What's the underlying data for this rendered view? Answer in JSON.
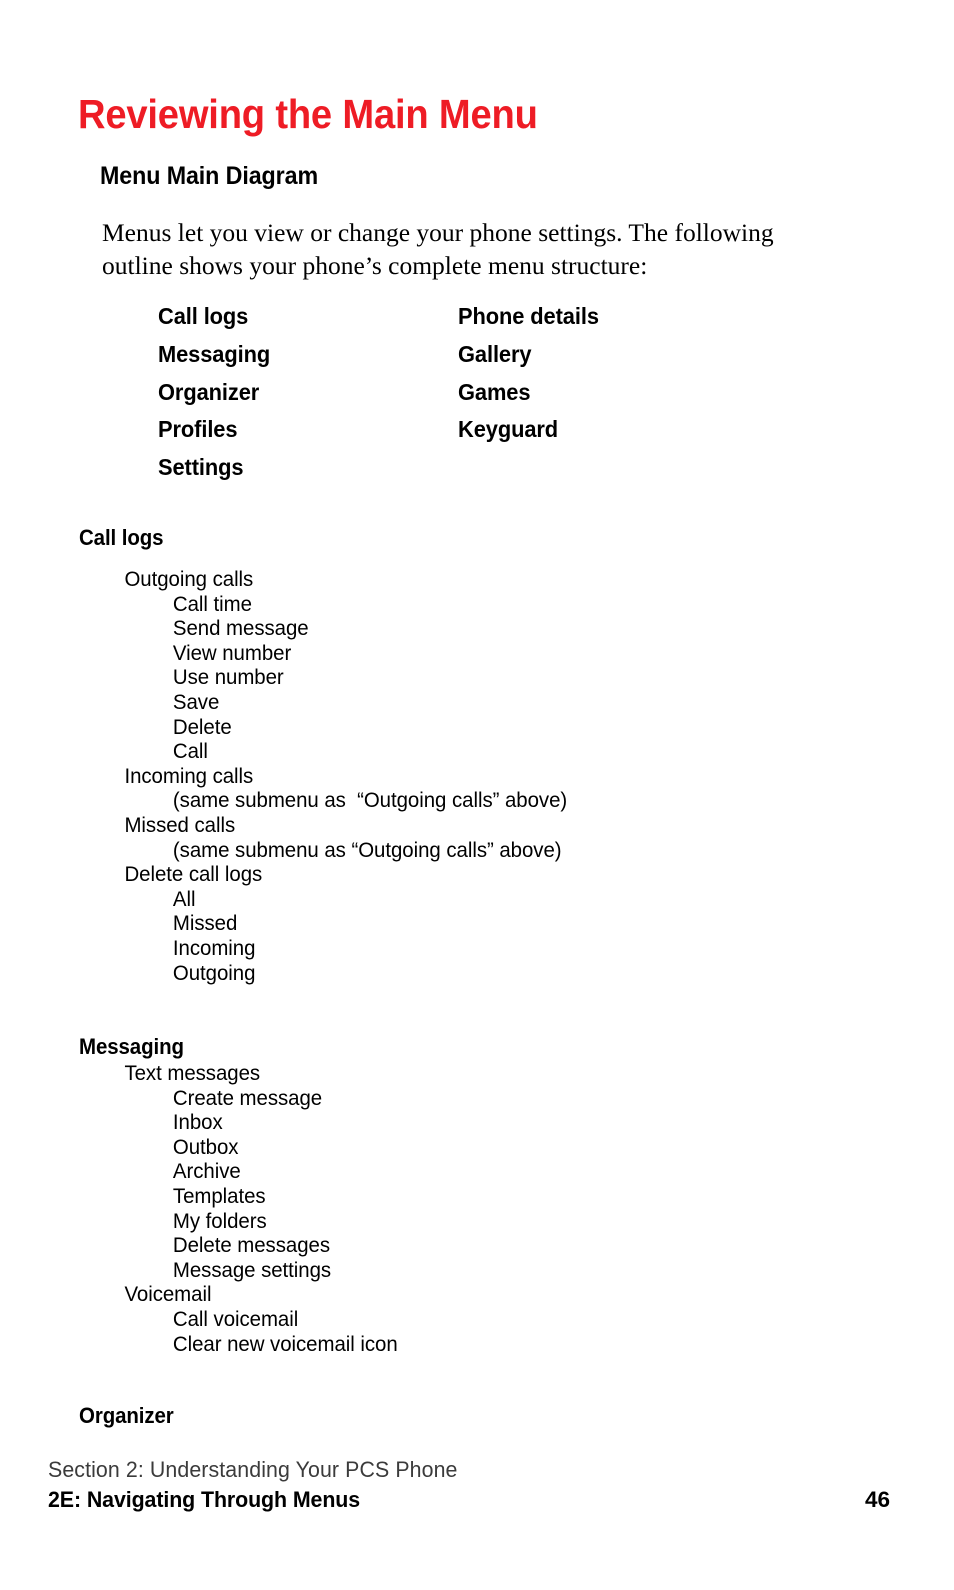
{
  "page": {
    "title": "Reviewing the Main Menu",
    "sub_heading": "Menu Main Diagram",
    "intro": "Menus let you view or change your phone settings. The following outline shows your phone’s complete menu structure:",
    "title_color": "#ee1c25",
    "text_color": "#000000",
    "footer_section_color": "#3b3b3b",
    "background_color": "#ffffff"
  },
  "main_menu": {
    "left_column": [
      {
        "label": "Call logs"
      },
      {
        "label": "Messaging"
      },
      {
        "label": "Organizer"
      },
      {
        "label": "Profiles"
      },
      {
        "label": "Settings"
      }
    ],
    "right_column": [
      {
        "label": "Phone details"
      },
      {
        "label": "Gallery"
      },
      {
        "label": "Games"
      },
      {
        "label": "Keyguard"
      }
    ]
  },
  "sections": [
    {
      "heading": "Call logs",
      "rows": [
        {
          "level": 1,
          "text": "Outgoing calls"
        },
        {
          "level": 2,
          "text": "Call time"
        },
        {
          "level": 2,
          "text": "Send message"
        },
        {
          "level": 2,
          "text": "View number"
        },
        {
          "level": 2,
          "text": "Use number"
        },
        {
          "level": 2,
          "text": "Save"
        },
        {
          "level": 2,
          "text": "Delete"
        },
        {
          "level": 2,
          "text": "Call"
        },
        {
          "level": 1,
          "text": "Incoming calls"
        },
        {
          "level": 2,
          "text": "(same submenu as  “Outgoing calls” above)"
        },
        {
          "level": 1,
          "text": "Missed calls"
        },
        {
          "level": 2,
          "text": "(same submenu as “Outgoing calls” above)"
        },
        {
          "level": 1,
          "text": "Delete call logs"
        },
        {
          "level": 2,
          "text": "All"
        },
        {
          "level": 2,
          "text": "Missed"
        },
        {
          "level": 2,
          "text": "Incoming"
        },
        {
          "level": 2,
          "text": "Outgoing"
        }
      ]
    },
    {
      "heading": "Messaging",
      "rows": [
        {
          "level": 1,
          "text": "Text messages"
        },
        {
          "level": 2,
          "text": "Create message"
        },
        {
          "level": 2,
          "text": "Inbox"
        },
        {
          "level": 2,
          "text": "Outbox"
        },
        {
          "level": 2,
          "text": "Archive"
        },
        {
          "level": 2,
          "text": "Templates"
        },
        {
          "level": 2,
          "text": "My folders"
        },
        {
          "level": 2,
          "text": "Delete messages"
        },
        {
          "level": 2,
          "text": "Message settings"
        },
        {
          "level": 1,
          "text": "Voicemail"
        },
        {
          "level": 2,
          "text": "Call voicemail"
        },
        {
          "level": 2,
          "text": "Clear new voicemail icon"
        }
      ]
    },
    {
      "heading": "Organizer",
      "rows": []
    }
  ],
  "footer": {
    "section_line": "Section 2: Understanding Your PCS Phone",
    "chapter_line": "2E: Navigating Through Menus",
    "page_number": "46"
  }
}
